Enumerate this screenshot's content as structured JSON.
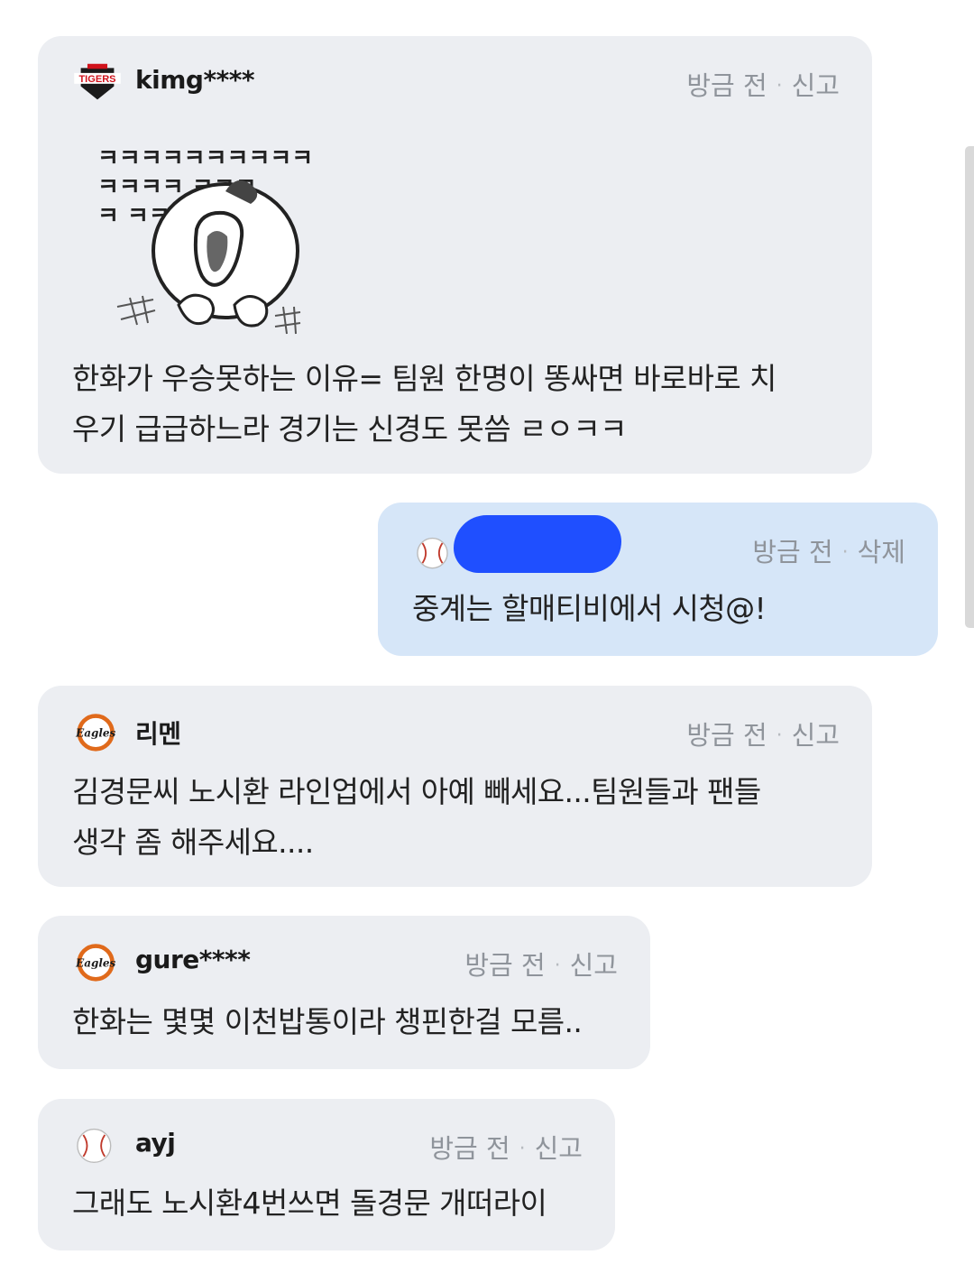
{
  "comments": [
    {
      "team_logo": "tigers-logo",
      "username": "kimg****",
      "time": "방금 전",
      "action": "신고",
      "sticker_text": [
        "ㅋㅋㅋㅋㅋㅋㅋㅋㅋㅋ",
        "ㅋㅋㅋㅋ ㅋㅋㅋ",
        "ㅋ ㅋㅋ"
      ],
      "text": "한화가 우승못하는 이유= 팀원 한명이 똥싸면 바로바로 치\n우기 급급하느라 경기는 신경도 못씀 ㄹㅇㅋㅋ"
    },
    {
      "team_logo": "baseball-icon",
      "username": "",
      "time": "방금 전",
      "action": "삭제",
      "text": "중계는 할매티비에서 시청@!"
    },
    {
      "team_logo": "eagles-logo",
      "username": "리멘",
      "time": "방금 전",
      "action": "신고",
      "text": "김경문씨 노시환 라인업에서 아예 빼세요...팀원들과 팬들\n생각 좀 해주세요...."
    },
    {
      "team_logo": "eagles-logo",
      "username": "gure****",
      "time": "방금 전",
      "action": "신고",
      "text": "한화는 몇몇 이천밥통이라 챙핀한걸 모름.."
    },
    {
      "team_logo": "baseball-icon",
      "username": "ayj",
      "time": "방금 전",
      "action": "신고",
      "text": "그래도 노시환4번쓰면 돌경문 개떠라이"
    }
  ],
  "logos": {
    "tigers": "TIGERS",
    "eagles": "Eagles"
  },
  "colors": {
    "bubble": "#eceef2",
    "mine_bubble": "#d6e6f8",
    "meta": "#8f949b",
    "redaction": "#1f4fff"
  }
}
